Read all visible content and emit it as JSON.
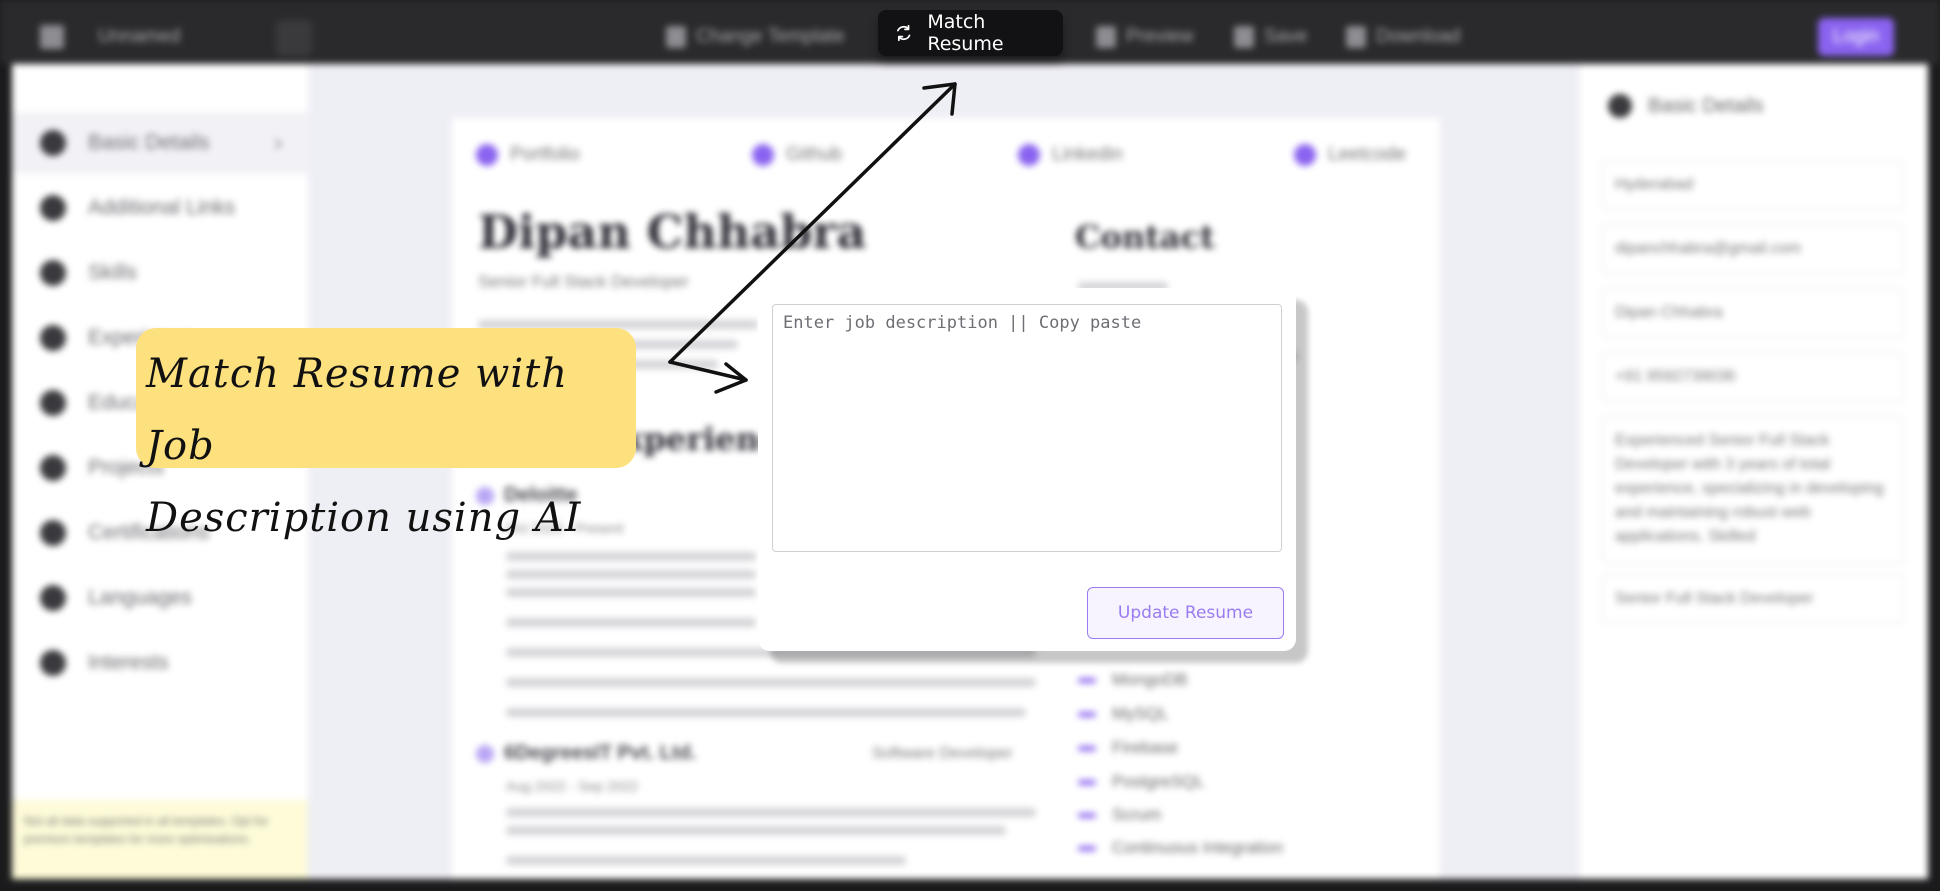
{
  "topbar": {
    "filename": "Unnamed",
    "change_template": "Change Template",
    "match_resume": "Match Resume",
    "preview": "Preview",
    "save": "Save",
    "download": "Download",
    "login": "Login"
  },
  "sidebar": {
    "items": [
      {
        "label": "Basic Details",
        "icon": "user-icon"
      },
      {
        "label": "Additional Links",
        "icon": "link-icon"
      },
      {
        "label": "Skills",
        "icon": "tools-icon"
      },
      {
        "label": "Experience",
        "icon": "briefcase-icon"
      },
      {
        "label": "Education",
        "icon": "book-icon"
      },
      {
        "label": "Projects",
        "icon": "project-icon"
      },
      {
        "label": "Certifications",
        "icon": "certificate-icon"
      },
      {
        "label": "Languages",
        "icon": "language-icon"
      },
      {
        "label": "Interests",
        "icon": "heart-icon"
      }
    ],
    "tip": "Not all data supported in all templates. Opt for premium templates for more optimisations."
  },
  "resume": {
    "links": [
      "Portfolio",
      "Github",
      "Linkedin",
      "Leetcode"
    ],
    "name": "Dipan Chhabra",
    "role": "Senior Full Stack Developer",
    "contact_heading": "Contact",
    "experience_heading": "Experience",
    "jobs": [
      {
        "company": "Deloitte",
        "dates": "Oct 2022 - Present"
      },
      {
        "company": "6DegreesIT Pvt. Ltd.",
        "title": "Software Developer",
        "dates": "Aug 2022 - Sep 2022"
      }
    ],
    "skills": [
      "MongoDB",
      "MySQL",
      "Firebase",
      "PostgreSQL",
      "Scrum",
      "Continuous Integration"
    ]
  },
  "right_panel": {
    "heading": "Basic Details",
    "fields": [
      "Hyderabad",
      "dipanchhabra@gmail.com",
      "Dipan Chhabra",
      "+91 9592739036",
      "Experienced Senior Full Stack Developer with 3 years of total experience, specializing in developing and maintaining robust web applications. Skilled",
      "Senior Full Stack Developer"
    ]
  },
  "modal": {
    "placeholder": "Enter job description || Copy paste",
    "update_button": "Update Resume"
  },
  "callout": {
    "line1": "Match Resume with Job",
    "line2": "Description using AI"
  },
  "colors": {
    "accent": "#8a63f0",
    "callout_bg": "#fce17e",
    "topbar": "#2a2a2c"
  }
}
